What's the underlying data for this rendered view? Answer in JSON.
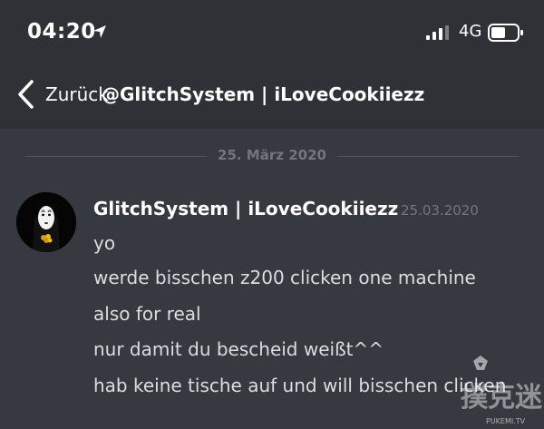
{
  "status_bar": {
    "time": "04:20",
    "network": "4G"
  },
  "nav": {
    "back_label": "Zurück",
    "title": "@GlitchSystem | iLoveCookiiezz"
  },
  "date_divider": "25. März 2020",
  "message": {
    "author": "GlitchSystem | iLoveCookiiezz",
    "timestamp": "25.03.2020",
    "lines": [
      "yo",
      "werde bisschen z200 clicken one machine",
      "also for real",
      "nur damit du bescheid weißt^^",
      "hab keine tische auf und will bisschen clicken"
    ]
  },
  "watermark": {
    "logo_text": "撲克迷",
    "site": "PUKEMI.TV"
  },
  "colors": {
    "background": "#36393f",
    "header": "#2f3136",
    "muted": "#72767d",
    "text": "#dcddde"
  }
}
